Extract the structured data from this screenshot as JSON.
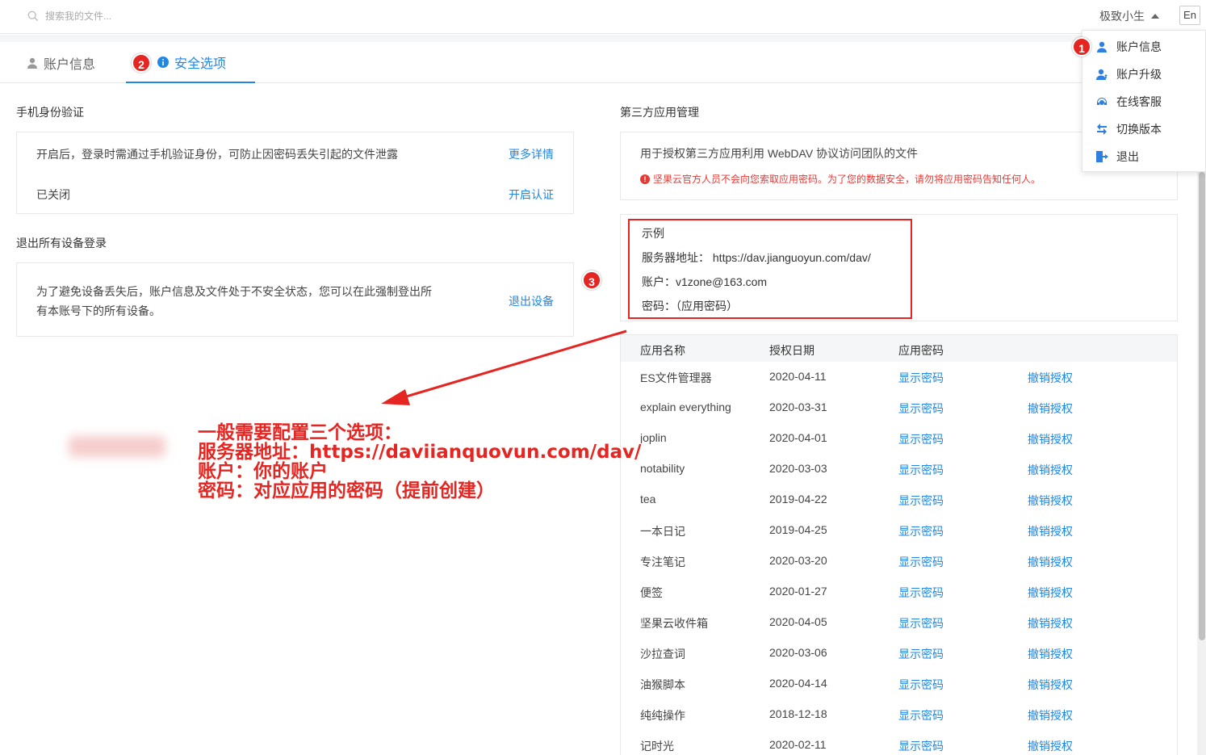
{
  "header": {
    "search_placeholder": "搜索我的文件...",
    "username": "极致小生",
    "lang_button": "En"
  },
  "tabs": [
    {
      "label": "账户信息",
      "active": false
    },
    {
      "label": "安全选项",
      "active": true
    }
  ],
  "badges": {
    "b1": "1",
    "b2": "2",
    "b3": "3"
  },
  "phone_verify": {
    "title": "手机身份验证",
    "description": "开启后，登录时需通过手机验证身份，可防止因密码丢失引起的文件泄露",
    "more_link": "更多详情",
    "status": "已关闭",
    "enable_link": "开启认证"
  },
  "logout_all": {
    "title": "退出所有设备登录",
    "description_line1": "为了避免设备丢失后，账户信息及文件处于不安全状态，您可以在此强制登出所",
    "description_line2": "有本账号下的所有设备。",
    "logout_link": "退出设备"
  },
  "third_party": {
    "title": "第三方应用管理",
    "description": "用于授权第三方应用利用 WebDAV 协议访问团队的文件",
    "warning": "坚果云官方人员不会向您索取应用密码。为了您的数据安全，请勿将应用密码告知任何人。",
    "example": {
      "heading": "示例",
      "server": "服务器地址：   https://dav.jianguoyun.com/dav/",
      "account": "账户：v1zone@163.com",
      "password": "密码：（应用密码）"
    },
    "table": {
      "headers": [
        "应用名称",
        "授权日期",
        "应用密码"
      ],
      "show_label": "显示密码",
      "revoke_label": "撤销授权",
      "rows": [
        {
          "name": "ES文件管理器",
          "date": "2020-04-11"
        },
        {
          "name": "explain everything",
          "date": "2020-03-31"
        },
        {
          "name": "joplin",
          "date": "2020-04-01"
        },
        {
          "name": "notability",
          "date": "2020-03-03"
        },
        {
          "name": "tea",
          "date": "2019-04-22"
        },
        {
          "name": "一本日记",
          "date": "2019-04-25"
        },
        {
          "name": "专注笔记",
          "date": "2020-03-20"
        },
        {
          "name": "便签",
          "date": "2020-01-27"
        },
        {
          "name": "坚果云收件箱",
          "date": "2020-04-05"
        },
        {
          "name": "沙拉查词",
          "date": "2020-03-06"
        },
        {
          "name": "油猴脚本",
          "date": "2020-04-14"
        },
        {
          "name": "纯纯操作",
          "date": "2018-12-18"
        },
        {
          "name": "记时光",
          "date": "2020-02-11"
        }
      ]
    }
  },
  "dropdown": [
    {
      "label": "账户信息",
      "icon": "user-icon"
    },
    {
      "label": "账户升级",
      "icon": "user-upgrade-icon"
    },
    {
      "label": "在线客服",
      "icon": "headset-icon"
    },
    {
      "label": "切换版本",
      "icon": "switch-icon"
    },
    {
      "label": "退出",
      "icon": "logout-icon"
    }
  ],
  "annotation": {
    "line1": "一般需要配置三个选项：",
    "line2": "服务器地址：https://daviianquovun.com/dav/",
    "line3": "账户：你的账户",
    "line4": "密码：对应应用的密码（提前创建）"
  },
  "colors": {
    "accent": "#1f87e8",
    "danger": "#e52521"
  }
}
